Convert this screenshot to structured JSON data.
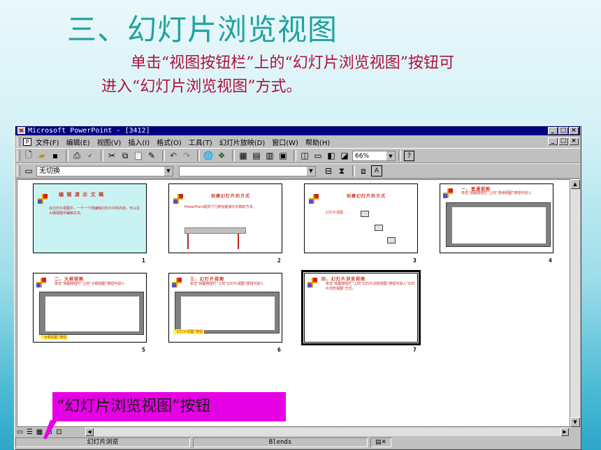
{
  "slide": {
    "title": "三、幻灯片浏览视图",
    "description_line1": "单击“视图按钮栏”上的“幻灯片浏览视图”按钮可",
    "description_line2": "进入“幻灯片浏览视图”方式。",
    "callout_label": "“幻灯片浏览视图”按钮"
  },
  "window": {
    "title": "Microsoft PowerPoint - [3412]",
    "min": "_",
    "max": "□",
    "close": "×"
  },
  "menu": [
    "文件(F)",
    "编辑(E)",
    "视图(V)",
    "插入(I)",
    "格式(O)",
    "工具(T)",
    "幻灯片放映(D)",
    "窗口(W)",
    "帮助(H)"
  ],
  "toolbar": {
    "zoom": "66%",
    "transition": "无切换",
    "help": "?"
  },
  "thumbnails": [
    {
      "num": "1",
      "title": "编 辑 演 示 文 稿",
      "text": "在幻灯片视图中，一个一个地编辑幻灯片中的内容，可以在大纲视图中编辑文本。"
    },
    {
      "num": "2",
      "title": "创建幻灯片的方式",
      "text": "PowerPoint提供了几种创建演示文稿的方法。"
    },
    {
      "num": "3",
      "title": "创建幻灯片的方式",
      "text": "幻灯片视图"
    },
    {
      "num": "4",
      "title": "一、普通视图",
      "text": "单击“视图按钮栏”上的“普通视图”按钮可进入"
    },
    {
      "num": "5",
      "title": "二、大纲视图",
      "text": "单击“视图按钮栏”上的“大纲视图”按钮可进入"
    },
    {
      "num": "6",
      "title": "三、幻灯片视图",
      "text": "单击“视图按钮栏”上的“幻灯片视图”按钮可进入"
    },
    {
      "num": "7",
      "title": "四、幻灯片浏览视图",
      "text": "单击“视图按钮栏”上的“幻灯片浏览视图”按钮可进入“幻灯片浏览视图”方式。"
    }
  ],
  "status": {
    "view": "幻灯片浏览",
    "design": "Blends"
  },
  "colors": {
    "title": "#1fa3a0",
    "description": "#b0103a",
    "callout_bg": "#e600e6",
    "titlebar": "#000080"
  }
}
